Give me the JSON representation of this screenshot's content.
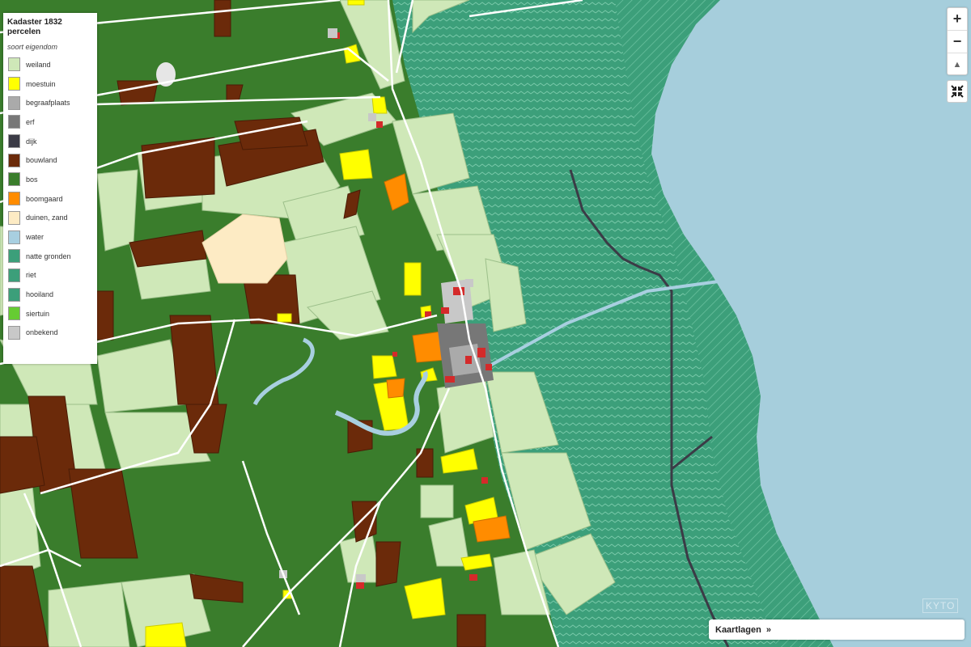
{
  "legend": {
    "title": "Kadaster 1832 percelen",
    "subtitle": "soort eigendom",
    "items": [
      {
        "label": "weiland",
        "color": "#cfe8b8"
      },
      {
        "label": "moestuin",
        "color": "#ffff00"
      },
      {
        "label": "begraafplaats",
        "color": "#aaaaaa"
      },
      {
        "label": "erf",
        "color": "#777777"
      },
      {
        "label": "dijk",
        "color": "#3b3b46"
      },
      {
        "label": "bouwland",
        "color": "#6b2a0a"
      },
      {
        "label": "bos",
        "color": "#3a7d2c"
      },
      {
        "label": "boomgaard",
        "color": "#ff8c00"
      },
      {
        "label": "duinen, zand",
        "color": "#fdebc4"
      },
      {
        "label": "water",
        "color": "#a8cfe0"
      },
      {
        "label": "natte gronden",
        "color": "#3c9f7a"
      },
      {
        "label": "riet",
        "color": "#3c9f7a"
      },
      {
        "label": "hooiland",
        "color": "#3c9f7a"
      },
      {
        "label": "siertuin",
        "color": "#66cc33"
      },
      {
        "label": "onbekend",
        "color": "#c8c8c8"
      }
    ]
  },
  "controls": {
    "zoom_in": "+",
    "zoom_out": "−",
    "reset_north": "▲"
  },
  "layers": {
    "label": "Kaartlagen",
    "arrow": "»"
  },
  "watermark": "KYTO",
  "colors": {
    "bos": "#3a7d2c",
    "weiland": "#cfe8b8",
    "bouwland": "#6b2a0a",
    "moestuin": "#ffff00",
    "boomgaard": "#ff8c00",
    "duinen": "#fdebc4",
    "water": "#a8cfe0",
    "wet": "#3c9f7a",
    "sea": "#a6cedc",
    "buildings": "#d42a2a",
    "road": "#ffffff",
    "dijk": "#3b3b46"
  }
}
